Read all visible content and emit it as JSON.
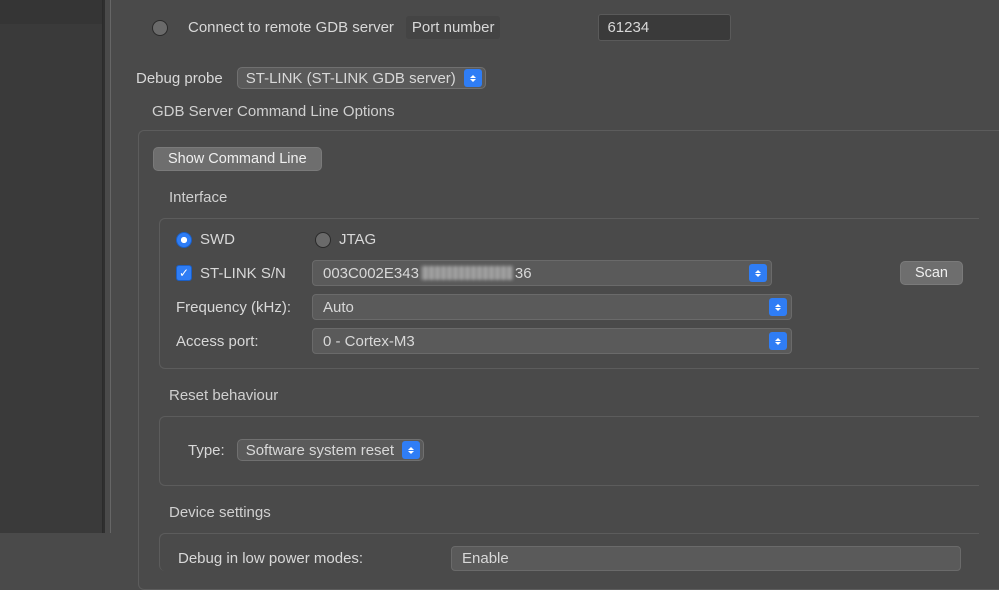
{
  "connect": {
    "remote_label": "Connect to remote GDB server",
    "port_label": "Port number",
    "port_value": "61234"
  },
  "debug_probe": {
    "label": "Debug probe",
    "value": "ST-LINK (ST-LINK GDB server)"
  },
  "gdb_options": {
    "heading": "GDB Server Command Line Options",
    "show_cmd_btn": "Show Command Line",
    "interface": {
      "heading": "Interface",
      "swd": "SWD",
      "jtag": "JTAG",
      "sn_label": "ST-LINK S/N",
      "sn_prefix": "003C002E343",
      "sn_suffix": "36",
      "scan_btn": "Scan",
      "freq_label": "Frequency (kHz):",
      "freq_value": "Auto",
      "access_port_label": "Access port:",
      "access_port_value": "0 - Cortex-M3"
    },
    "reset": {
      "heading": "Reset behaviour",
      "type_label": "Type:",
      "type_value": "Software system reset"
    },
    "device": {
      "heading": "Device settings",
      "low_power_label": "Debug in low power modes:",
      "low_power_value": "Enable"
    }
  }
}
